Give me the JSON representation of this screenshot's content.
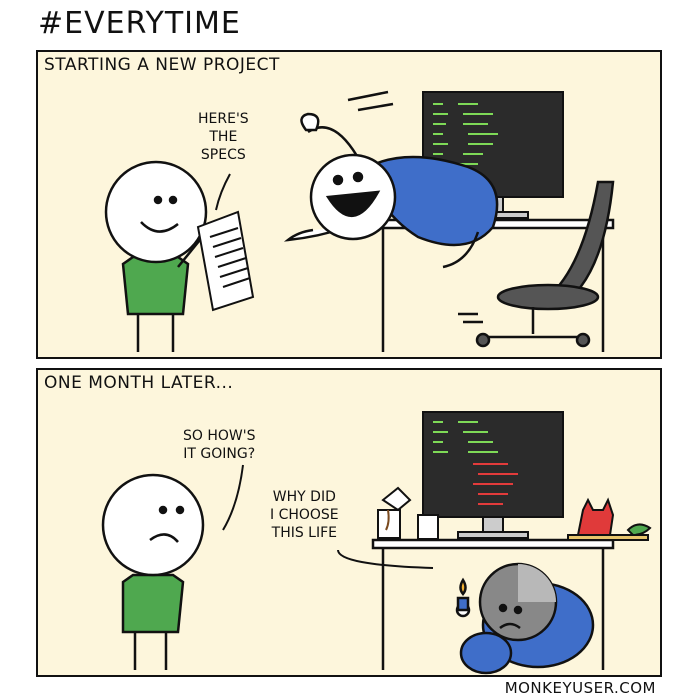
{
  "title": "#EVERYTIME",
  "panels": [
    {
      "caption": "STARTING A NEW PROJECT",
      "speech": [
        "HERE'S",
        "THE",
        "SPECS"
      ]
    },
    {
      "caption": "ONE MONTH LATER...",
      "speech_manager": [
        "SO HOW'S",
        "IT GOING?"
      ],
      "speech_dev": [
        "WHY DID",
        "I CHOOSE",
        "THIS LIFE"
      ]
    }
  ],
  "footer": "MONKEYUSER.COM",
  "colors": {
    "panel_bg": "#fdf6dc",
    "shirt_green": "#4fa84f",
    "shirt_blue": "#3f6ec9",
    "monitor": "#2b2b2b",
    "code_green": "#7ed957",
    "code_red": "#e23b3b",
    "cat_red": "#e03a3a"
  }
}
